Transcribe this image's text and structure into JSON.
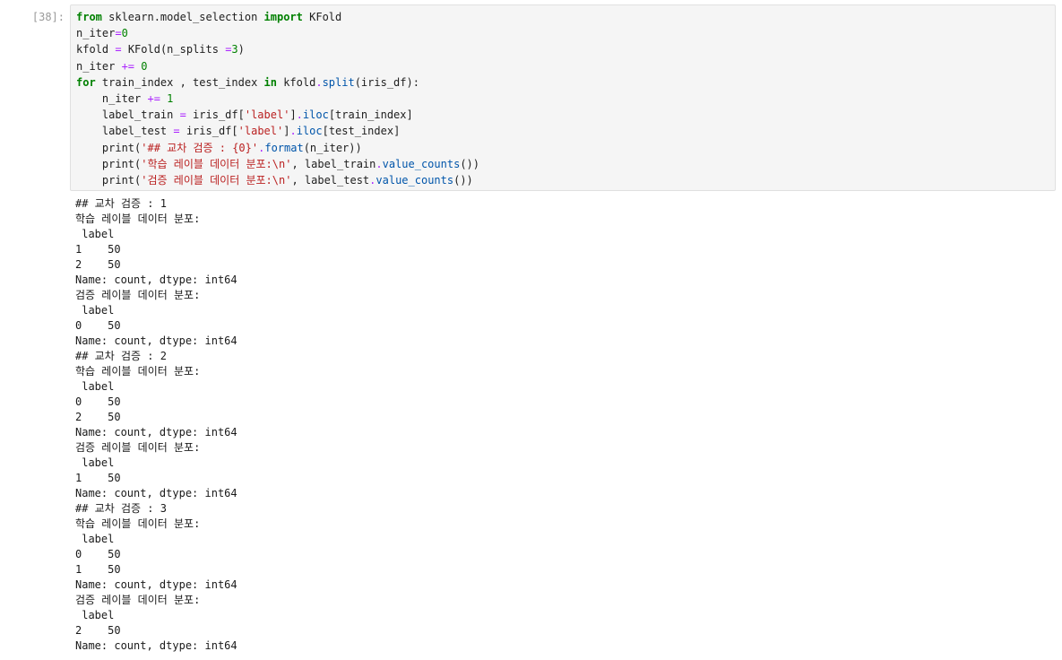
{
  "cell": {
    "prompt": "[38]:"
  },
  "code_lines": [
    [
      {
        "t": "from",
        "c": "kw"
      },
      {
        "t": " sklearn.model_selection ",
        "c": ""
      },
      {
        "t": "import",
        "c": "kw"
      },
      {
        "t": " KFold",
        "c": ""
      }
    ],
    [
      {
        "t": "n_iter",
        "c": ""
      },
      {
        "t": "=",
        "c": "op"
      },
      {
        "t": "0",
        "c": "num"
      }
    ],
    [
      {
        "t": "kfold ",
        "c": ""
      },
      {
        "t": "=",
        "c": "op"
      },
      {
        "t": " KFold(n_splits ",
        "c": ""
      },
      {
        "t": "=",
        "c": "op"
      },
      {
        "t": "3",
        "c": "num"
      },
      {
        "t": ")",
        "c": ""
      }
    ],
    [
      {
        "t": "n_iter ",
        "c": ""
      },
      {
        "t": "+=",
        "c": "op"
      },
      {
        "t": " ",
        "c": ""
      },
      {
        "t": "0",
        "c": "num"
      }
    ],
    [
      {
        "t": "for",
        "c": "kw"
      },
      {
        "t": " train_index , test_index ",
        "c": ""
      },
      {
        "t": "in",
        "c": "kw"
      },
      {
        "t": " kfold",
        "c": ""
      },
      {
        "t": ".",
        "c": "op"
      },
      {
        "t": "split",
        "c": "fn"
      },
      {
        "t": "(iris_df):",
        "c": ""
      }
    ],
    [
      {
        "t": "    n_iter ",
        "c": ""
      },
      {
        "t": "+=",
        "c": "op"
      },
      {
        "t": " ",
        "c": ""
      },
      {
        "t": "1",
        "c": "num"
      }
    ],
    [
      {
        "t": "    label_train ",
        "c": ""
      },
      {
        "t": "=",
        "c": "op"
      },
      {
        "t": " iris_df[",
        "c": ""
      },
      {
        "t": "'label'",
        "c": "str"
      },
      {
        "t": "]",
        "c": ""
      },
      {
        "t": ".",
        "c": "op"
      },
      {
        "t": "iloc",
        "c": "fn"
      },
      {
        "t": "[train_index]",
        "c": ""
      }
    ],
    [
      {
        "t": "    label_test ",
        "c": ""
      },
      {
        "t": "=",
        "c": "op"
      },
      {
        "t": " iris_df[",
        "c": ""
      },
      {
        "t": "'label'",
        "c": "str"
      },
      {
        "t": "]",
        "c": ""
      },
      {
        "t": ".",
        "c": "op"
      },
      {
        "t": "iloc",
        "c": "fn"
      },
      {
        "t": "[test_index]",
        "c": ""
      }
    ],
    [
      {
        "t": "    print(",
        "c": ""
      },
      {
        "t": "'## 교차 검증 : {0}'",
        "c": "str"
      },
      {
        "t": ".",
        "c": "op"
      },
      {
        "t": "format",
        "c": "fn"
      },
      {
        "t": "(n_iter))",
        "c": ""
      }
    ],
    [
      {
        "t": "    print(",
        "c": ""
      },
      {
        "t": "'학습 레이블 데이터 분포:\\n'",
        "c": "str"
      },
      {
        "t": ", label_train",
        "c": ""
      },
      {
        "t": ".",
        "c": "op"
      },
      {
        "t": "value_counts",
        "c": "fn"
      },
      {
        "t": "())",
        "c": ""
      }
    ],
    [
      {
        "t": "    print(",
        "c": ""
      },
      {
        "t": "'검증 레이블 데이터 분포:\\n'",
        "c": "str"
      },
      {
        "t": ", label_test",
        "c": ""
      },
      {
        "t": ".",
        "c": "op"
      },
      {
        "t": "value_counts",
        "c": "fn"
      },
      {
        "t": "())",
        "c": ""
      }
    ]
  ],
  "output_lines": [
    "## 교차 검증 : 1",
    "학습 레이블 데이터 분포:",
    " label",
    "1    50",
    "2    50",
    "Name: count, dtype: int64",
    "검증 레이블 데이터 분포:",
    " label",
    "0    50",
    "Name: count, dtype: int64",
    "## 교차 검증 : 2",
    "학습 레이블 데이터 분포:",
    " label",
    "0    50",
    "2    50",
    "Name: count, dtype: int64",
    "검증 레이블 데이터 분포:",
    " label",
    "1    50",
    "Name: count, dtype: int64",
    "## 교차 검증 : 3",
    "학습 레이블 데이터 분포:",
    " label",
    "0    50",
    "1    50",
    "Name: count, dtype: int64",
    "검증 레이블 데이터 분포:",
    " label",
    "2    50",
    "Name: count, dtype: int64"
  ]
}
